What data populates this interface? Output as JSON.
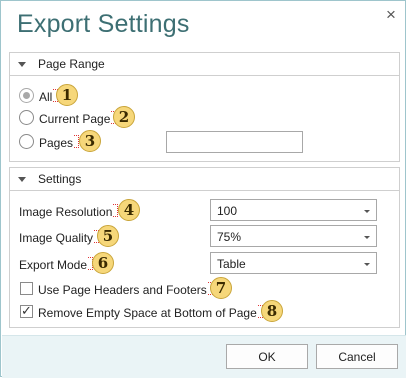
{
  "window": {
    "title": "Export Settings",
    "close_icon": "×"
  },
  "page_range": {
    "header": "Page Range",
    "options": [
      {
        "label": "All",
        "checked": true,
        "badge": "1"
      },
      {
        "label": "Current Page",
        "checked": false,
        "badge": "2"
      },
      {
        "label": "Pages",
        "checked": false,
        "badge": "3"
      }
    ],
    "pages_value": ""
  },
  "settings": {
    "header": "Settings",
    "image_resolution": {
      "label": "Image Resolution",
      "value": "100",
      "badge": "4"
    },
    "image_quality": {
      "label": "Image Quality",
      "value": "75%",
      "badge": "5"
    },
    "export_mode": {
      "label": "Export Mode",
      "value": "Table",
      "badge": "6"
    },
    "use_headers_footers": {
      "label": "Use Page Headers and Footers",
      "checked": false,
      "badge": "7"
    },
    "remove_empty_space": {
      "label": "Remove Empty Space at Bottom of Page",
      "checked": true,
      "badge": "8"
    }
  },
  "buttons": {
    "ok": "OK",
    "cancel": "Cancel"
  },
  "colors": {
    "title": "#3d6f73",
    "footer_bg": "#eaf4f6",
    "badge": "#f6d77a"
  }
}
